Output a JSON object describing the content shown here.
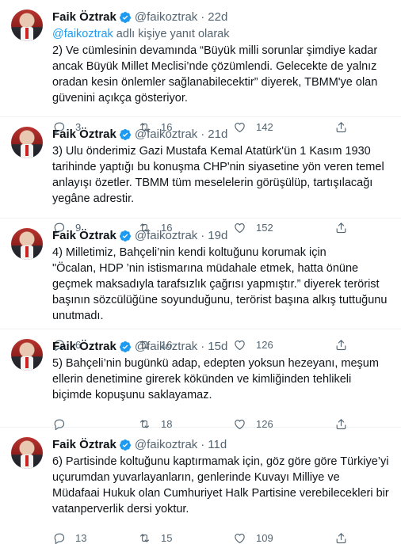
{
  "tweets": [
    {
      "name": "Faik Öztrak",
      "handle": "@faikoztrak",
      "time": "22d",
      "reply_prefix": "@faikoztrak",
      "reply_suffix": " adlı kişiye yanıt olarak",
      "text": "2) Ve cümlesinin devamında “Büyük milli sorunlar şimdiye kadar ancak Büyük Millet Meclisi’nde çözümlendi. Gelecekte de yalnız oradan kesin önlemler sağlanabilecektir” diyerek, TBMM'ye olan güvenini açıkça gösteriyor.",
      "replies": "3",
      "retweets": "16",
      "likes": "142"
    },
    {
      "name": "Faik Öztrak",
      "handle": "@faikoztrak",
      "time": "21d",
      "text": "3) Ulu önderimiz Gazi Mustafa Kemal Atatürk'ün 1 Kasım 1930 tarihinde yaptığı bu konuşma CHP'nin siyasetine yön veren temel anlayışı özetler. TBMM tüm meselelerin görüşülüp, tartışılacağı yegâne adrestir.",
      "replies": "9",
      "retweets": "16",
      "likes": "152"
    },
    {
      "name": "Faik Öztrak",
      "handle": "@faikoztrak",
      "time": "19d",
      "text": "4) Milletimiz, Bahçeli’nin kendi koltuğunu korumak için\n\"Öcalan, HDP ’nin istismarına müdahale etmek, hatta önüne geçmek maksadıyla tarafsızlık çağrısı yapmıştır.” diyerek terörist başının sözcülüğüne soyunduğunu, terörist başına alkış tuttuğunu unutmadı.",
      "replies": "6",
      "retweets": "16",
      "likes": "126"
    },
    {
      "name": "Faik Öztrak",
      "handle": "@faikoztrak",
      "time": "15d",
      "text": "5) Bahçeli’nin bugünkü adap, edepten yoksun hezeyanı, meşum ellerin denetimine girerek kökünden ve kimliğinden tehlikeli biçimde kopuşunu saklayamaz.",
      "replies": "",
      "retweets": "18",
      "likes": "126"
    },
    {
      "name": "Faik Öztrak",
      "handle": "@faikoztrak",
      "time": "11d",
      "text": "6) Partisinde koltuğunu kaptırmamak için, göz göre göre Türkiye’yi uçurumdan yuvarlayanların, genlerinde Kuvayı Milliye ve Müdafaai Hukuk olan Cumhuriyet Halk Partisine verebilecekleri bir vatanperverlik dersi yoktur.",
      "replies": "13",
      "retweets": "15",
      "likes": "109"
    }
  ],
  "colors": {
    "text": "#0f1419",
    "muted": "#536471",
    "accent": "#1d9bf0",
    "border": "#eff3f4"
  },
  "icons": [
    "verified-badge-icon",
    "reply-icon",
    "retweet-icon",
    "like-icon",
    "share-icon"
  ]
}
